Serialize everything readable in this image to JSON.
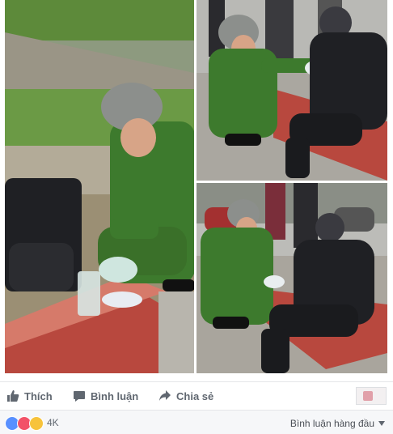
{
  "actions": {
    "like_label": "Thích",
    "comment_label": "Bình luận",
    "share_label": "Chia sẻ"
  },
  "reactions": {
    "types": [
      "like",
      "love",
      "wow"
    ],
    "count": "4K"
  },
  "comments_filter": {
    "label": "Bình luận hàng đầu"
  },
  "colors": {
    "uniform_green": "#3d7a2d",
    "jacket_black": "#1f2024",
    "curb_red": "#b8483e",
    "like_blue": "#5890ff"
  },
  "icons": [
    "thumbs-up-icon",
    "comment-icon",
    "share-icon",
    "chevron-down-icon"
  ]
}
